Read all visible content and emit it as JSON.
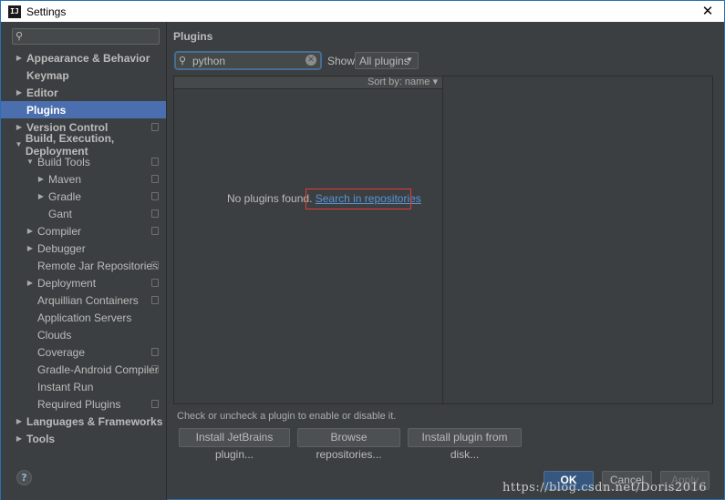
{
  "window": {
    "title": "Settings",
    "app_icon": "intellij-icon"
  },
  "sidebar": {
    "search_placeholder": "",
    "items": [
      {
        "label": "Appearance & Behavior",
        "arrow": "▶",
        "bold": true,
        "indent": 0
      },
      {
        "label": "Keymap",
        "arrow": "",
        "bold": true,
        "indent": 0
      },
      {
        "label": "Editor",
        "arrow": "▶",
        "bold": true,
        "indent": 0
      },
      {
        "label": "Plugins",
        "arrow": "",
        "bold": true,
        "indent": 0,
        "selected": true
      },
      {
        "label": "Version Control",
        "arrow": "▶",
        "bold": true,
        "indent": 0,
        "copy": true
      },
      {
        "label": "Build, Execution, Deployment",
        "arrow": "▼",
        "bold": true,
        "indent": 0
      },
      {
        "label": "Build Tools",
        "arrow": "▼",
        "bold": false,
        "indent": 1,
        "copy": true
      },
      {
        "label": "Maven",
        "arrow": "▶",
        "bold": false,
        "indent": 2,
        "copy": true
      },
      {
        "label": "Gradle",
        "arrow": "▶",
        "bold": false,
        "indent": 2,
        "copy": true
      },
      {
        "label": "Gant",
        "arrow": "",
        "bold": false,
        "indent": 2,
        "copy": true
      },
      {
        "label": "Compiler",
        "arrow": "▶",
        "bold": false,
        "indent": 1,
        "copy": true
      },
      {
        "label": "Debugger",
        "arrow": "▶",
        "bold": false,
        "indent": 1
      },
      {
        "label": "Remote Jar Repositories",
        "arrow": "",
        "bold": false,
        "indent": 1,
        "copy": true
      },
      {
        "label": "Deployment",
        "arrow": "▶",
        "bold": false,
        "indent": 1,
        "copy": true
      },
      {
        "label": "Arquillian Containers",
        "arrow": "",
        "bold": false,
        "indent": 1,
        "copy": true
      },
      {
        "label": "Application Servers",
        "arrow": "",
        "bold": false,
        "indent": 1
      },
      {
        "label": "Clouds",
        "arrow": "",
        "bold": false,
        "indent": 1
      },
      {
        "label": "Coverage",
        "arrow": "",
        "bold": false,
        "indent": 1,
        "copy": true
      },
      {
        "label": "Gradle-Android Compiler",
        "arrow": "",
        "bold": false,
        "indent": 1,
        "copy": true
      },
      {
        "label": "Instant Run",
        "arrow": "",
        "bold": false,
        "indent": 1
      },
      {
        "label": "Required Plugins",
        "arrow": "",
        "bold": false,
        "indent": 1,
        "copy": true
      },
      {
        "label": "Languages & Frameworks",
        "arrow": "▶",
        "bold": true,
        "indent": 0
      },
      {
        "label": "Tools",
        "arrow": "▶",
        "bold": true,
        "indent": 0
      }
    ],
    "help_label": "?"
  },
  "main": {
    "title": "Plugins",
    "search_value": "python",
    "show_label": "Show:",
    "show_selected": "All plugins",
    "sort_label": "Sort by: name ▾",
    "empty_text": "No plugins found.",
    "repo_link": "Search in repositories",
    "hint": "Check or uncheck a plugin to enable or disable it.",
    "buttons": {
      "install_jetbrains": "Install JetBrains plugin...",
      "browse_repos": "Browse repositories...",
      "install_disk": "Install plugin from disk..."
    }
  },
  "footer": {
    "ok": "OK",
    "cancel": "Cancel",
    "apply": "Apply"
  },
  "watermark": "https://blog.csdn.net/Doris2016",
  "colors": {
    "accent": "#4b6eaf",
    "link": "#5894d7",
    "highlight": "#e53935",
    "background": "#3c3f41"
  }
}
